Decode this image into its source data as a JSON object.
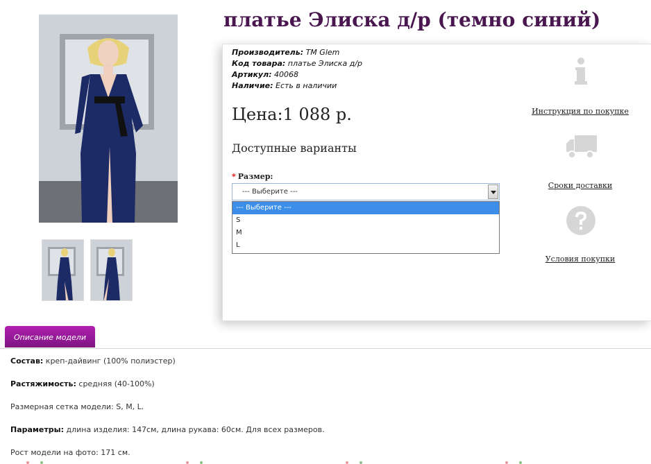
{
  "product": {
    "title": "платье Элиска д/р (темно синий)",
    "specs": [
      {
        "label": "Производитель:",
        "value": " TM Glem"
      },
      {
        "label": "Код товара:",
        "value": " платье Элиска д/р"
      },
      {
        "label": "Артикул:",
        "value": " 40068"
      },
      {
        "label": "Наличие:",
        "value": " Есть в наличии"
      }
    ],
    "price": "Цена:1 088 р.",
    "variants_heading": "Доступные варианты",
    "size": {
      "required_mark": "*",
      "label": "Размер:",
      "selected": "--- Выберите ---",
      "options": [
        "--- Выберите ---",
        "S",
        "M",
        "L"
      ]
    }
  },
  "side_links": [
    {
      "label": "Инструкция по покупке",
      "icon": "info-icon"
    },
    {
      "label": "Сроки доставки",
      "icon": "truck-icon"
    },
    {
      "label": "Условия покупки",
      "icon": "question-icon"
    }
  ],
  "tabs": [
    {
      "label": "Описание модели"
    }
  ],
  "description": [
    {
      "label": "Состав:",
      "value": " креп-дайвинг (100% полиэстер)"
    },
    {
      "label": "Растяжимость:",
      "value": " средняя (40-100%)"
    },
    {
      "label": "Размерная сетка модели:",
      "value": " S, M, L."
    },
    {
      "label": "Параметры:",
      "value": " длина изделия: 147см, длина рукава: 60см. Для всех размеров."
    },
    {
      "label": "Рост модели на фото:",
      "value": " 171 см."
    }
  ],
  "colors": {
    "title": "#4a1650",
    "tab": "#9a1a9c",
    "dropdown_highlight": "#3d8ee8",
    "dress": "#1c2a66"
  }
}
